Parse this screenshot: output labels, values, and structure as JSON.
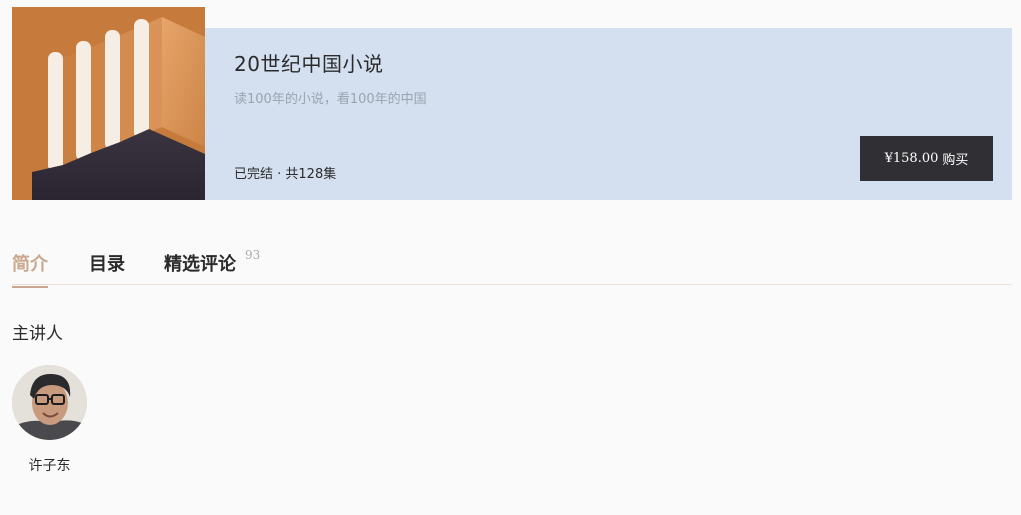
{
  "course": {
    "title": "20世纪中国小说",
    "subtitle": "读100年的小说，看100年的中国",
    "status": "已完结 · 共128集",
    "price": "¥158.00",
    "buy_label": "购买"
  },
  "tabs": [
    {
      "label": "简介",
      "active": true
    },
    {
      "label": "目录",
      "active": false
    },
    {
      "label": "精选评论",
      "active": false,
      "count": "93"
    }
  ],
  "intro": {
    "section_heading": "主讲人",
    "lecturers": [
      {
        "name": "许子东",
        "avatar_icon": "lecturer-avatar"
      }
    ]
  },
  "colors": {
    "banner_bg": "#d4e0f0",
    "cover_bg": "#c67b3d",
    "buy_button_bg": "#2f2f34",
    "active_tab": "#c9a88f"
  },
  "icons": {
    "cover": "book-cover-pillars-art"
  }
}
